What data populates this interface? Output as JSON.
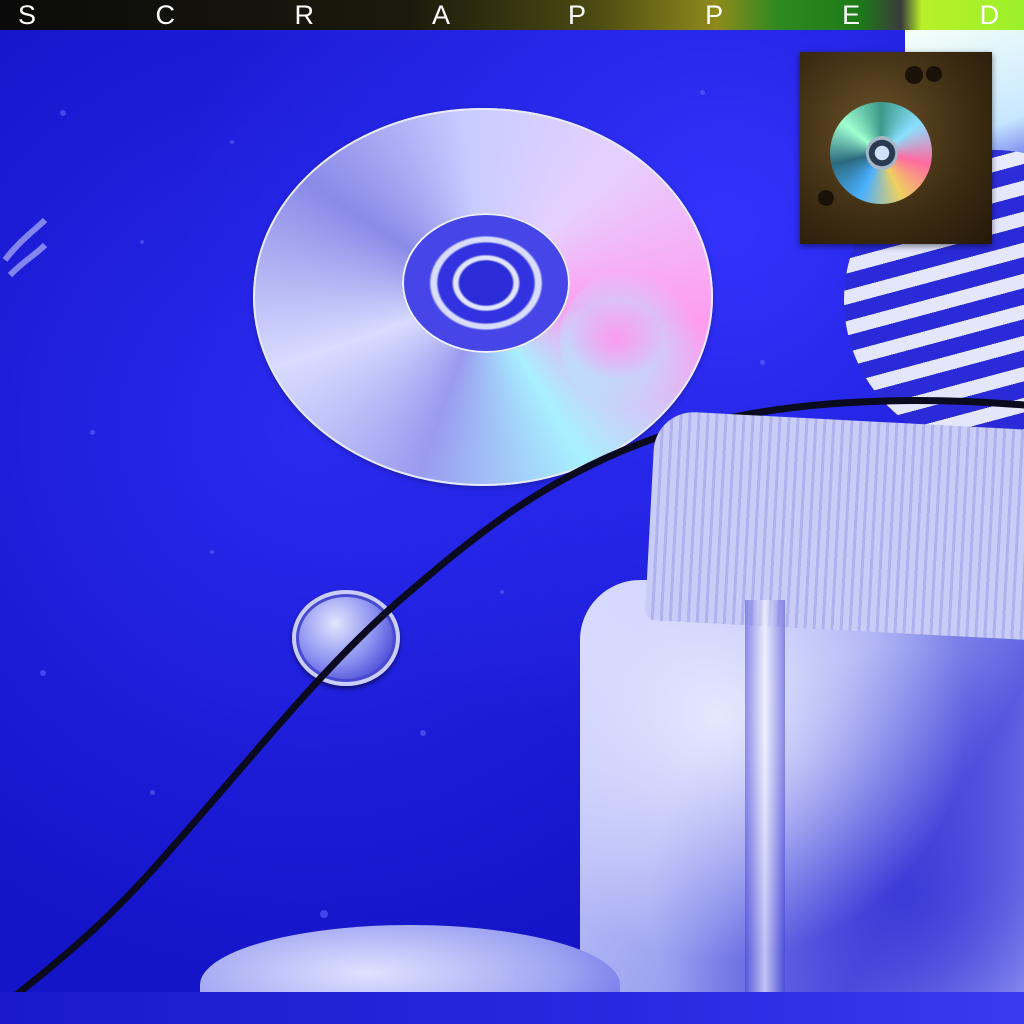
{
  "title": "S C R A P P E D"
}
